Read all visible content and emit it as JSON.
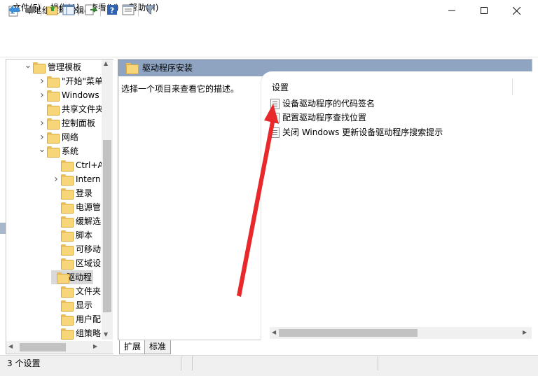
{
  "window": {
    "title": "本地组策略编辑器",
    "controls": {
      "minimize": "—",
      "maximize": "☐",
      "close": "✕"
    }
  },
  "menu": {
    "file": "文件(F)",
    "action": "操作(A)",
    "view": "查看(V)",
    "help": "帮助(H)"
  },
  "toolbar": {
    "icons": [
      "back-arrow-icon",
      "forward-arrow-icon",
      "up-folder-icon",
      "show-hide-tree-icon",
      "export-list-icon",
      "help-icon",
      "properties-view-icon",
      "filter-icon"
    ]
  },
  "tree": {
    "items": [
      {
        "label": "管理模板",
        "arrow": "expanded"
      },
      {
        "label": "\"开始\"菜单",
        "arrow": "collapsed"
      },
      {
        "label": "Windows",
        "arrow": "collapsed"
      },
      {
        "label": "共享文件夹",
        "arrow": "none"
      },
      {
        "label": "控制面板",
        "arrow": "collapsed"
      },
      {
        "label": "网络",
        "arrow": "collapsed"
      },
      {
        "label": "系统",
        "arrow": "expanded"
      },
      {
        "label": "Ctrl+A",
        "arrow": "none"
      },
      {
        "label": "Intern",
        "arrow": "collapsed"
      },
      {
        "label": "登录",
        "arrow": "none"
      },
      {
        "label": "电源管",
        "arrow": "none"
      },
      {
        "label": "缓解选",
        "arrow": "none"
      },
      {
        "label": "脚本",
        "arrow": "none"
      },
      {
        "label": "可移动",
        "arrow": "none"
      },
      {
        "label": "区域设",
        "arrow": "none"
      },
      {
        "label": "驱动程",
        "arrow": "none",
        "selected": true
      },
      {
        "label": "文件夹",
        "arrow": "none"
      },
      {
        "label": "显示",
        "arrow": "none"
      },
      {
        "label": "用户配",
        "arrow": "none"
      },
      {
        "label": "组策略",
        "arrow": "none"
      }
    ]
  },
  "main": {
    "header": "驱动程序安装",
    "description": "选择一个项目来查看它的描述。",
    "column_header": "设置",
    "settings": [
      "设备驱动程序的代码签名",
      "配置驱动程序查找位置",
      "关闭 Windows 更新设备驱动程序搜索提示"
    ]
  },
  "tabs": {
    "extended": "扩展",
    "standard": "标准"
  },
  "status": {
    "text": "3 个设置"
  },
  "colors": {
    "header_band": "#8ea4c1",
    "folder": "#f7d67a",
    "annotation_arrow": "#e8282a"
  }
}
